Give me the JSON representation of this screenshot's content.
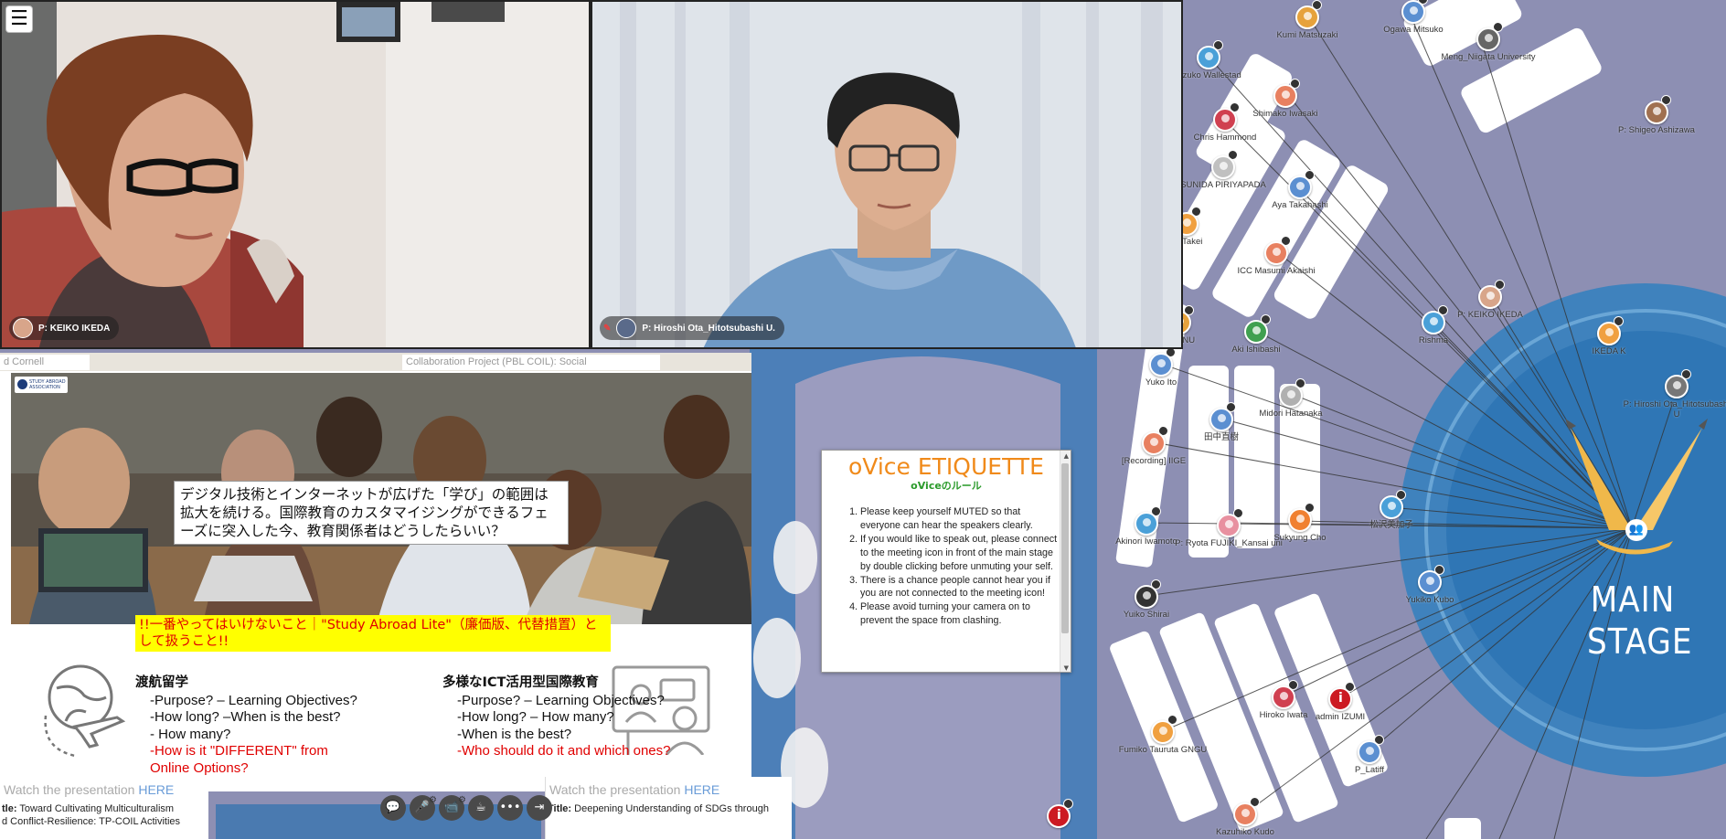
{
  "menu": {
    "icon": "hamburger-icon",
    "label": "☰"
  },
  "videos": [
    {
      "name": "P: KEIKO IKEDA"
    },
    {
      "name": "P: Hiroshi Ota_Hitotsubashi U."
    }
  ],
  "presentation": {
    "tabs": [
      "d Cornell",
      "Collaboration Project (PBL COIL): Social"
    ],
    "logo": "STUDY ABROAD ASSOCIATION",
    "question": "デジタル技術とインターネットが広げた「学び」の範囲は拡大を続ける。国際教育のカスタマイジングができるフェーズに突入した今、教育関係者はどうしたらいい？",
    "warning": "!!一番やってはいけないこと｜\"Study Abroad Lite\"（廉価版、代替措置）として扱うこと!!",
    "study_abroad": {
      "heading": "渡航留学",
      "lines": [
        "-Purpose? – Learning Objectives?",
        "-How long? –When is the best?",
        "- How many?"
      ],
      "red_lines": [
        "-How is it \"DIFFERENT\" from",
        "Online Options?"
      ]
    },
    "ict": {
      "heading": "多様なICT活用型国際教育",
      "lines": [
        "-Purpose? – Learning Objectives?",
        "-How long? – How many?",
        "-When is the best?"
      ],
      "red_lines": [
        "-Who should do it and which ones?"
      ]
    }
  },
  "bottom": {
    "left_watch": "Watch the presentation",
    "left_here": "HERE",
    "left_title_label": "tle:",
    "left_title_line1": "Toward Cultivating Multiculturalism",
    "left_title_line2": "d Conflict-Resilience: TP-COIL Activities",
    "right_watch": "Watch the presentation",
    "right_here": "HERE",
    "right_title_label": "Title:",
    "right_title": "Deepening Understanding of SDGs through"
  },
  "controls": [
    {
      "name": "chat-icon",
      "glyph": "💬"
    },
    {
      "name": "mic-muted-icon",
      "glyph": "🎤"
    },
    {
      "name": "camera-off-icon",
      "glyph": "📹"
    },
    {
      "name": "coffee-icon",
      "glyph": "☕"
    },
    {
      "name": "more-icon",
      "glyph": "•••"
    },
    {
      "name": "exit-icon",
      "glyph": "⇥"
    }
  ],
  "etiquette": {
    "title": "oVice ETIQUETTE",
    "subtitle": "oViceのルール",
    "rules": [
      "Please keep yourself MUTED so that everyone can hear the speakers clearly.",
      "If you would like to speak out, please connect to the meeting icon in front of the main stage by double clicking before unmuting your self.",
      "There is a chance people cannot hear you if you are not connected to the meeting icon!",
      "Please avoid turning your camera on to prevent the space from clashing."
    ]
  },
  "stage": {
    "line1": "MAIN",
    "line2": "STAGE"
  },
  "avatars": [
    {
      "name": "Kumi Matsuzaki",
      "color": "#e6a23c"
    },
    {
      "name": "Ogawa Mitsuko",
      "color": "#5b8fd1"
    },
    {
      "name": "Meng_Niigata University",
      "color": "#666666"
    },
    {
      "name": "P: Shigeo Ashizawa",
      "color": "#a07050"
    },
    {
      "name": "aizuko Wallestad",
      "color": "#4aa0d8"
    },
    {
      "name": "Shimako Iwasaki",
      "color": "#e88060"
    },
    {
      "name": "Chris Hammond",
      "color": "#d04050"
    },
    {
      "name": "SUNIDA PIRIYAPADA",
      "color": "#c0c0c0"
    },
    {
      "name": "Aya Takahashi",
      "color": "#5b8fd1"
    },
    {
      "name": "ko Takei",
      "color": "#f0a040"
    },
    {
      "name": "ICC Masumi Akaishi",
      "color": "#e88060"
    },
    {
      "name": "Rishma",
      "color": "#4aa0d8"
    },
    {
      "name": "P: KEIKO IKEDA",
      "color": "#d8a58a"
    },
    {
      "name": "IKEDA K",
      "color": "#f0a040"
    },
    {
      "name": "P: Hiroshi Ota_Hitotsubashi U",
      "color": "#777777"
    },
    {
      "name": "ake_NU",
      "color": "#e6a23c"
    },
    {
      "name": "Aki Ishibashi",
      "color": "#40a050"
    },
    {
      "name": "Yuko Ito",
      "color": "#5b8fd1"
    },
    {
      "name": "Midori Hatanaka",
      "color": "#b0b0b0"
    },
    {
      "name": "田中直樹",
      "color": "#5b8fd1"
    },
    {
      "name": "[Recording] IIGE",
      "color": "#e88060"
    },
    {
      "name": "松沢美加子",
      "color": "#4aa0d8"
    },
    {
      "name": "Akinori Iwamoto",
      "color": "#4aa0d8"
    },
    {
      "name": "P: Ryota FUJIKI_Kansai uni",
      "color": "#e890a0"
    },
    {
      "name": "Sukyung Cho",
      "color": "#f08030"
    },
    {
      "name": "Yukiko Kubo",
      "color": "#5b8fd1"
    },
    {
      "name": "Yuiko Shirai",
      "color": "#333333"
    },
    {
      "name": "Hiroko Iwata",
      "color": "#d04050"
    },
    {
      "name": "admin IZUMI",
      "color": "#cc1a22",
      "red": true
    },
    {
      "name": "Fumiko Tauruta GNGU",
      "color": "#f0a040"
    },
    {
      "name": "P_Latiff",
      "color": "#5b8fd1"
    },
    {
      "name": "",
      "color": "#cc1a22",
      "red": true
    },
    {
      "name": "Kazuhiko Kudo",
      "color": "#e88060"
    }
  ]
}
